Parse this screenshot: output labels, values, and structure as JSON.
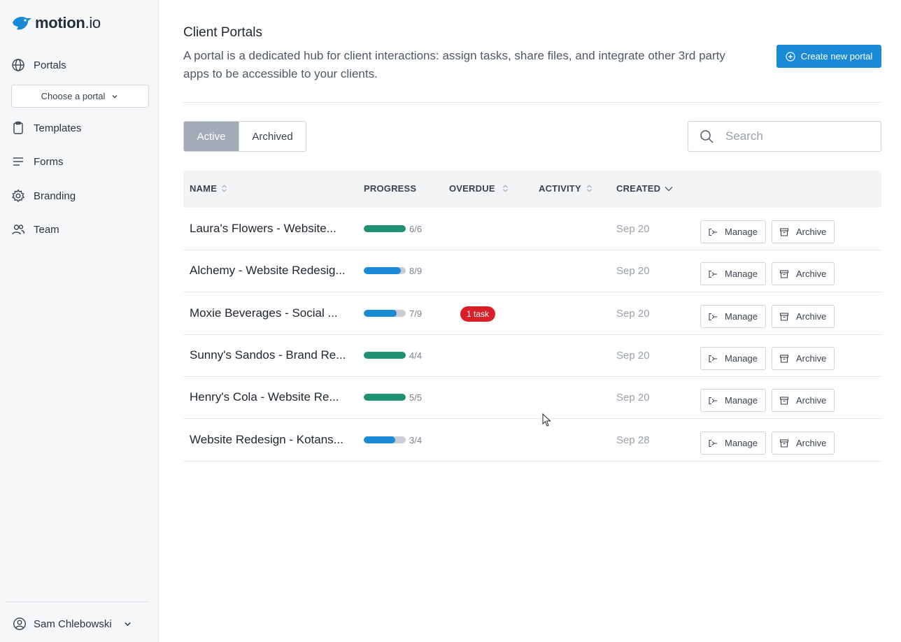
{
  "app": {
    "logo_text": "motion",
    "logo_suffix": ".io"
  },
  "sidebar": {
    "items": [
      {
        "label": "Portals",
        "icon": "globe-icon"
      },
      {
        "label": "Templates",
        "icon": "clipboard-icon"
      },
      {
        "label": "Forms",
        "icon": "lines-icon"
      },
      {
        "label": "Branding",
        "icon": "gear-icon"
      },
      {
        "label": "Team",
        "icon": "users-icon"
      }
    ],
    "portal_select": "Choose a portal",
    "user": "Sam Chlebowski"
  },
  "header": {
    "title": "Client Portals",
    "description": "A portal is a dedicated hub for client interactions: assign tasks, share files, and integrate other 3rd party apps to be accessible to your clients.",
    "create_label": "Create new portal"
  },
  "tabs": {
    "active": "Active",
    "archived": "Archived"
  },
  "search": {
    "placeholder": "Search"
  },
  "table": {
    "columns": {
      "name": "NAME",
      "progress": "PROGRESS",
      "overdue": "OVERDUE",
      "activity": "ACTIVITY",
      "created": "CREATED"
    },
    "manage_label": "Manage",
    "archive_label": "Archive",
    "rows": [
      {
        "name": "Laura's Flowers - Website...",
        "progress": "6/6",
        "done": 6,
        "total": 6,
        "overdue": "",
        "created": "Sep 20"
      },
      {
        "name": "Alchemy - Website Redesig...",
        "progress": "8/9",
        "done": 8,
        "total": 9,
        "overdue": "",
        "created": "Sep 20"
      },
      {
        "name": "Moxie Beverages - Social ...",
        "progress": "7/9",
        "done": 7,
        "total": 9,
        "overdue": "1 task",
        "created": "Sep 20"
      },
      {
        "name": "Sunny's Sandos - Brand Re...",
        "progress": "4/4",
        "done": 4,
        "total": 4,
        "overdue": "",
        "created": "Sep 20"
      },
      {
        "name": "Henry's Cola - Website Re...",
        "progress": "5/5",
        "done": 5,
        "total": 5,
        "overdue": "",
        "created": "Sep 20"
      },
      {
        "name": "Website Redesign - Kotans...",
        "progress": "3/4",
        "done": 3,
        "total": 4,
        "overdue": "",
        "created": "Sep 28"
      }
    ]
  },
  "colors": {
    "accent": "#1b8ad6",
    "complete": "#1f9170",
    "in_progress": "#1b8ad6",
    "overdue": "#d81f2a"
  }
}
